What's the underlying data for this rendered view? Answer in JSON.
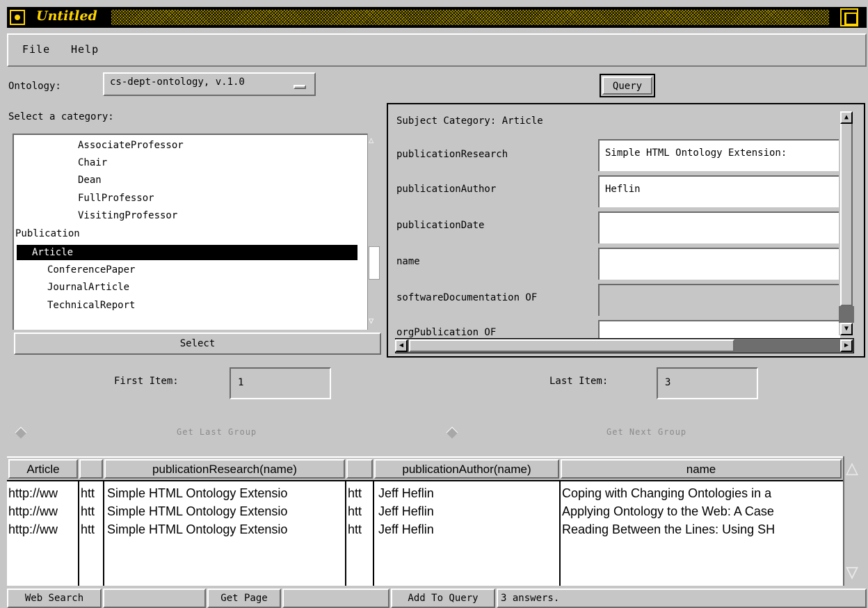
{
  "window": {
    "title": "Untitled"
  },
  "menu": {
    "file": "File",
    "help": "Help"
  },
  "ontology": {
    "label": "Ontology:",
    "value": "cs-dept-ontology, v.1.0"
  },
  "query_button": "Query",
  "category": {
    "label": "Select a category:",
    "items": [
      "AssociateProfessor",
      "Chair",
      "Dean",
      "FullProfessor",
      "VisitingProfessor",
      "Publication",
      "Article",
      "ConferencePaper",
      "JournalArticle",
      "TechnicalReport"
    ],
    "selected": "Article",
    "select_button": "Select"
  },
  "subject": {
    "label": "Subject Category: Article",
    "properties": [
      {
        "name": "publicationResearch",
        "value": "Simple HTML Ontology Extension:"
      },
      {
        "name": "publicationAuthor",
        "value": "Heflin"
      },
      {
        "name": "publicationDate",
        "value": ""
      },
      {
        "name": "name",
        "value": ""
      },
      {
        "name": "softwareDocumentation OF",
        "value": ""
      },
      {
        "name": "orgPublication OF",
        "value": ""
      }
    ]
  },
  "range": {
    "first_label": "First Item:",
    "first_value": "1",
    "last_label": "Last Item:",
    "last_value": "3",
    "last_group": "Get Last Group",
    "next_group": "Get Next Group"
  },
  "results": {
    "columns": [
      "Article",
      "",
      "publicationResearch(name)",
      "",
      "publicationAuthor(name)",
      "name"
    ],
    "rows": [
      [
        "http://ww",
        "htt",
        "Simple HTML Ontology Extensio",
        "htt",
        "Jeff Heflin",
        "Coping with Changing Ontologies in a"
      ],
      [
        "http://ww",
        "htt",
        "Simple HTML Ontology Extensio",
        "htt",
        "Jeff Heflin",
        "Applying Ontology to the Web: A Case"
      ],
      [
        "http://ww",
        "htt",
        "Simple HTML Ontology Extensio",
        "htt",
        "Jeff Heflin",
        "Reading Between the Lines: Using SH"
      ]
    ]
  },
  "status": {
    "web_search": "Web Search",
    "get_page": "Get Page",
    "add_to_query": "Add To Query",
    "answers": "3 answers."
  }
}
